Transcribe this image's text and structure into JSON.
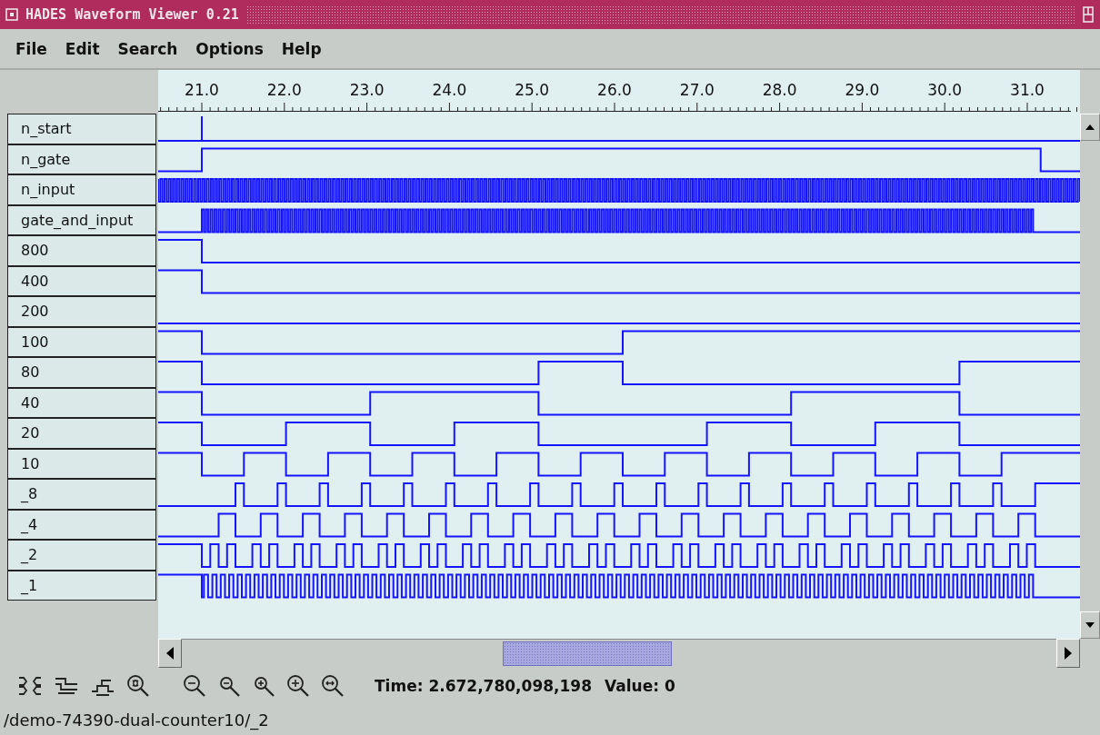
{
  "window": {
    "title": "HADES Waveform Viewer 0.21"
  },
  "menu": [
    "File",
    "Edit",
    "Search",
    "Options",
    "Help"
  ],
  "ruler": {
    "ticks": [
      "21.0",
      "22.0",
      "23.0",
      "24.0",
      "25.0",
      "26.0",
      "27.0",
      "28.0",
      "29.0",
      "30.0",
      "31.0"
    ]
  },
  "signals": [
    "n_start",
    "n_gate",
    "n_input",
    "gate_and_input",
    "800",
    "400",
    "200",
    "100",
    "80",
    "40",
    "20",
    "10",
    "_8",
    "_4",
    "_2",
    "_1"
  ],
  "status": {
    "time": "Time: 2.672,780,098,198",
    "value": "Value: 0"
  },
  "path": "/demo-74390-dual-counter10/_2"
}
